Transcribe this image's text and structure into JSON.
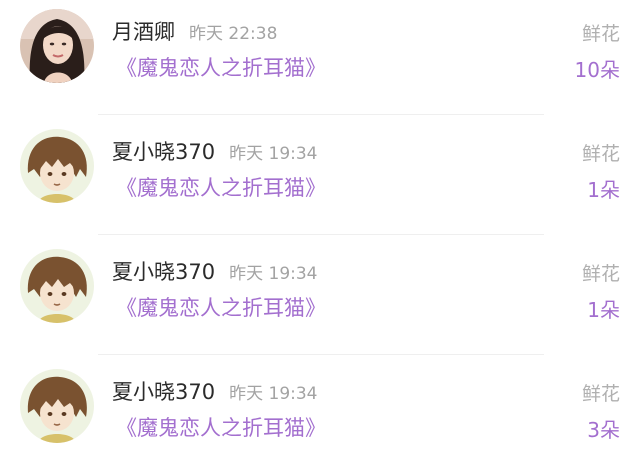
{
  "gifts": [
    {
      "user": "月酒卿",
      "time": "昨天 22:38",
      "book": "《魔鬼恋人之折耳猫》",
      "gift_type": "鲜花",
      "count": "10朵",
      "avatar": "woman-portrait"
    },
    {
      "user": "夏小晓370",
      "time": "昨天 19:34",
      "book": "《魔鬼恋人之折耳猫》",
      "gift_type": "鲜花",
      "count": "1朵",
      "avatar": "anime-boy"
    },
    {
      "user": "夏小晓370",
      "time": "昨天 19:34",
      "book": "《魔鬼恋人之折耳猫》",
      "gift_type": "鲜花",
      "count": "1朵",
      "avatar": "anime-boy"
    },
    {
      "user": "夏小晓370",
      "time": "昨天 19:34",
      "book": "《魔鬼恋人之折耳猫》",
      "gift_type": "鲜花",
      "count": "3朵",
      "avatar": "anime-boy"
    }
  ],
  "colors": {
    "accent": "#a36fcf",
    "name": "#2b2b2b",
    "muted": "#a3a3a3"
  }
}
